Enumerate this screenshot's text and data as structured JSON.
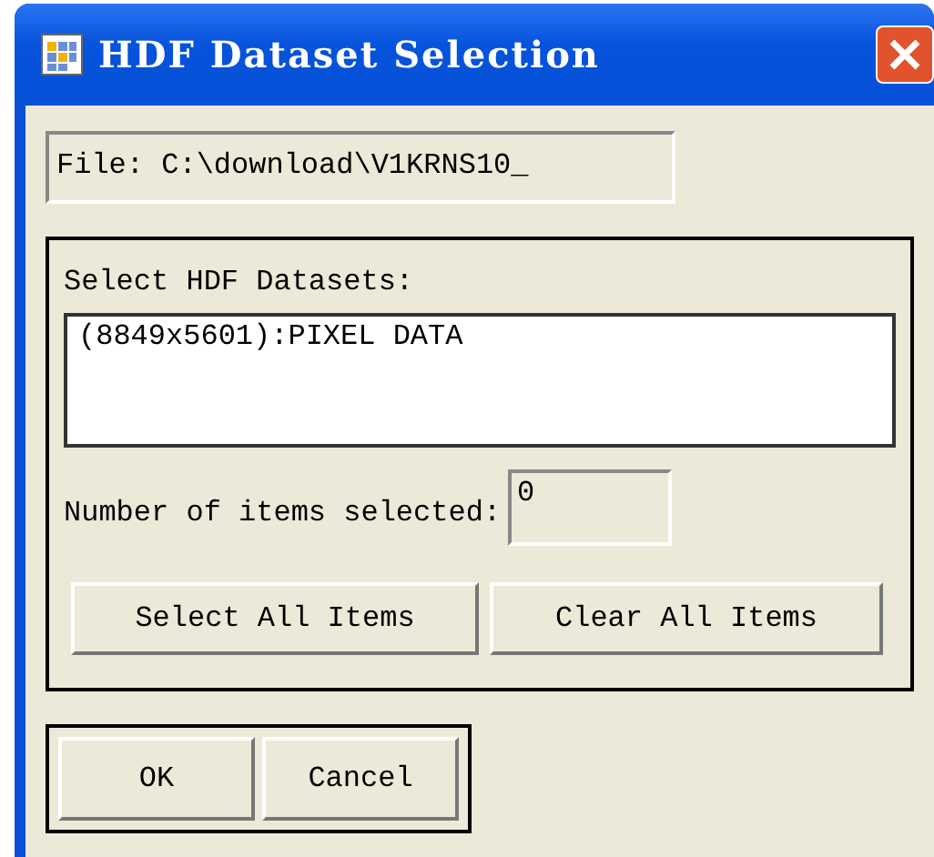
{
  "window": {
    "title": "HDF Dataset Selection"
  },
  "file_field": {
    "value": "File: C:\\download\\V1KRNS10_"
  },
  "datasets": {
    "label": "Select HDF Datasets:",
    "items": [
      {
        "text": "(8849x5601):PIXEL DATA",
        "selected": false
      }
    ]
  },
  "count": {
    "label": "Number of items selected:",
    "value": "0"
  },
  "selection_buttons": [
    "Select All Items",
    "Clear All Items"
  ],
  "dialog_buttons": [
    "OK",
    "Cancel"
  ]
}
